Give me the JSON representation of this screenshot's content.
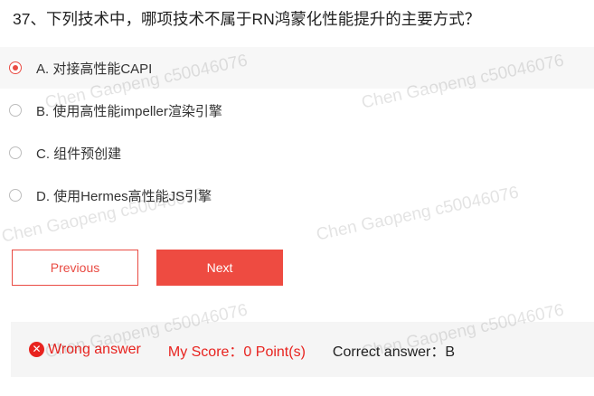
{
  "question": {
    "text": "37、下列技术中，哪项技术不属于RN鸿蒙化性能提升的主要方式？"
  },
  "options": [
    {
      "label": "A. 对接高性能CAPI",
      "selected": true
    },
    {
      "label": "B. 使用高性能impeller渲染引擎",
      "selected": false
    },
    {
      "label": "C. 组件预创建",
      "selected": false
    },
    {
      "label": "D. 使用Hermes高性能JS引擎",
      "selected": false
    }
  ],
  "buttons": {
    "previous": "Previous",
    "next": "Next"
  },
  "result": {
    "status": "Wrong answer",
    "score": "My Score：0 Point(s)",
    "correct": "Correct answer：B",
    "status_icon": "x-circle-icon"
  },
  "watermark": "Chen Gaopeng c50046076",
  "colors": {
    "accent": "#ee4b41",
    "error": "#e8231f"
  }
}
